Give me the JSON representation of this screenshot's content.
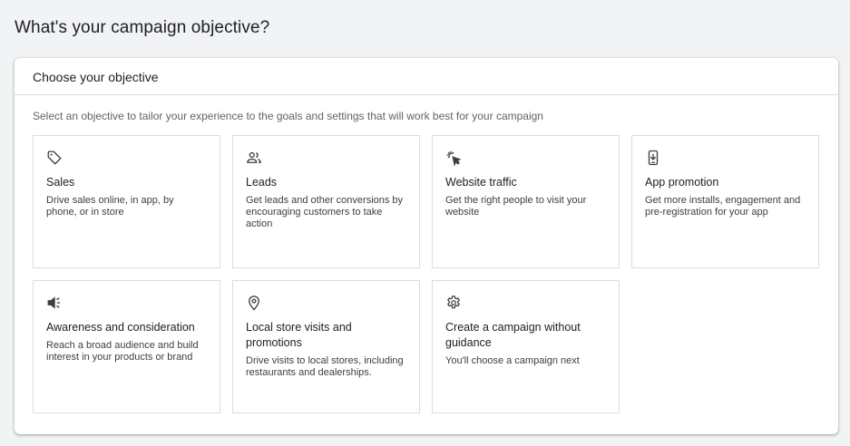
{
  "page": {
    "title": "What's your campaign objective?"
  },
  "panel": {
    "header": "Choose your objective",
    "subtitle": "Select an objective to tailor your experience to the goals and settings that will work best for your campaign"
  },
  "objectives": [
    {
      "icon": "tag-icon",
      "title": "Sales",
      "description": "Drive sales online, in app, by phone, or in store"
    },
    {
      "icon": "people-icon",
      "title": "Leads",
      "description": "Get leads and other conversions by encouraging customers to take action"
    },
    {
      "icon": "cursor-click-icon",
      "title": "Website traffic",
      "description": "Get the right people to visit your website"
    },
    {
      "icon": "phone-download-icon",
      "title": "App promotion",
      "description": "Get more installs, engagement and pre-registration for your app"
    },
    {
      "icon": "megaphone-icon",
      "title": "Awareness and consideration",
      "description": "Reach a broad audience and build interest in your products or brand"
    },
    {
      "icon": "location-pin-icon",
      "title": "Local store visits and promotions",
      "description": "Drive visits to local stores, including restaurants and dealerships."
    },
    {
      "icon": "gear-icon",
      "title": "Create a campaign without guidance",
      "description": "You'll choose a campaign next"
    }
  ],
  "colors": {
    "background": "#f1f3f4",
    "panel": "#ffffff",
    "border": "#dadce0",
    "text": "#202124",
    "subtext": "#5f6368"
  }
}
